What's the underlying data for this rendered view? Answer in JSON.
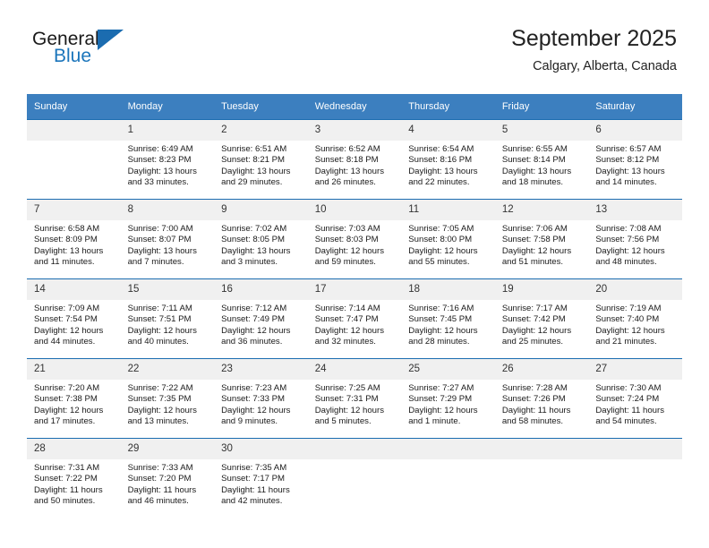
{
  "brand": {
    "name_top": "General",
    "name_bottom": "Blue",
    "triangle_icon": "triangle-logo-icon",
    "color_top": "#1a1a1a",
    "color_bottom": "#1b75bb"
  },
  "header": {
    "title": "September 2025",
    "subtitle": "Calgary, Alberta, Canada"
  },
  "theme": {
    "header_bg": "#3c7fbf",
    "header_text": "#ffffff",
    "row_divider": "#1b6cb0",
    "daynum_bg": "#f0f0f0",
    "cell_bg": "#ffffff"
  },
  "weekday_headers": [
    "Sunday",
    "Monday",
    "Tuesday",
    "Wednesday",
    "Thursday",
    "Friday",
    "Saturday"
  ],
  "labels": {
    "sunrise_prefix": "Sunrise:",
    "sunset_prefix": "Sunset:",
    "daylight_prefix": "Daylight:"
  },
  "weeks": [
    [
      {
        "day": "",
        "sunrise": "",
        "sunset": "",
        "daylight_line1": "",
        "daylight_line2": ""
      },
      {
        "day": "1",
        "sunrise": "Sunrise: 6:49 AM",
        "sunset": "Sunset: 8:23 PM",
        "daylight_line1": "Daylight: 13 hours",
        "daylight_line2": "and 33 minutes."
      },
      {
        "day": "2",
        "sunrise": "Sunrise: 6:51 AM",
        "sunset": "Sunset: 8:21 PM",
        "daylight_line1": "Daylight: 13 hours",
        "daylight_line2": "and 29 minutes."
      },
      {
        "day": "3",
        "sunrise": "Sunrise: 6:52 AM",
        "sunset": "Sunset: 8:18 PM",
        "daylight_line1": "Daylight: 13 hours",
        "daylight_line2": "and 26 minutes."
      },
      {
        "day": "4",
        "sunrise": "Sunrise: 6:54 AM",
        "sunset": "Sunset: 8:16 PM",
        "daylight_line1": "Daylight: 13 hours",
        "daylight_line2": "and 22 minutes."
      },
      {
        "day": "5",
        "sunrise": "Sunrise: 6:55 AM",
        "sunset": "Sunset: 8:14 PM",
        "daylight_line1": "Daylight: 13 hours",
        "daylight_line2": "and 18 minutes."
      },
      {
        "day": "6",
        "sunrise": "Sunrise: 6:57 AM",
        "sunset": "Sunset: 8:12 PM",
        "daylight_line1": "Daylight: 13 hours",
        "daylight_line2": "and 14 minutes."
      }
    ],
    [
      {
        "day": "7",
        "sunrise": "Sunrise: 6:58 AM",
        "sunset": "Sunset: 8:09 PM",
        "daylight_line1": "Daylight: 13 hours",
        "daylight_line2": "and 11 minutes."
      },
      {
        "day": "8",
        "sunrise": "Sunrise: 7:00 AM",
        "sunset": "Sunset: 8:07 PM",
        "daylight_line1": "Daylight: 13 hours",
        "daylight_line2": "and 7 minutes."
      },
      {
        "day": "9",
        "sunrise": "Sunrise: 7:02 AM",
        "sunset": "Sunset: 8:05 PM",
        "daylight_line1": "Daylight: 13 hours",
        "daylight_line2": "and 3 minutes."
      },
      {
        "day": "10",
        "sunrise": "Sunrise: 7:03 AM",
        "sunset": "Sunset: 8:03 PM",
        "daylight_line1": "Daylight: 12 hours",
        "daylight_line2": "and 59 minutes."
      },
      {
        "day": "11",
        "sunrise": "Sunrise: 7:05 AM",
        "sunset": "Sunset: 8:00 PM",
        "daylight_line1": "Daylight: 12 hours",
        "daylight_line2": "and 55 minutes."
      },
      {
        "day": "12",
        "sunrise": "Sunrise: 7:06 AM",
        "sunset": "Sunset: 7:58 PM",
        "daylight_line1": "Daylight: 12 hours",
        "daylight_line2": "and 51 minutes."
      },
      {
        "day": "13",
        "sunrise": "Sunrise: 7:08 AM",
        "sunset": "Sunset: 7:56 PM",
        "daylight_line1": "Daylight: 12 hours",
        "daylight_line2": "and 48 minutes."
      }
    ],
    [
      {
        "day": "14",
        "sunrise": "Sunrise: 7:09 AM",
        "sunset": "Sunset: 7:54 PM",
        "daylight_line1": "Daylight: 12 hours",
        "daylight_line2": "and 44 minutes."
      },
      {
        "day": "15",
        "sunrise": "Sunrise: 7:11 AM",
        "sunset": "Sunset: 7:51 PM",
        "daylight_line1": "Daylight: 12 hours",
        "daylight_line2": "and 40 minutes."
      },
      {
        "day": "16",
        "sunrise": "Sunrise: 7:12 AM",
        "sunset": "Sunset: 7:49 PM",
        "daylight_line1": "Daylight: 12 hours",
        "daylight_line2": "and 36 minutes."
      },
      {
        "day": "17",
        "sunrise": "Sunrise: 7:14 AM",
        "sunset": "Sunset: 7:47 PM",
        "daylight_line1": "Daylight: 12 hours",
        "daylight_line2": "and 32 minutes."
      },
      {
        "day": "18",
        "sunrise": "Sunrise: 7:16 AM",
        "sunset": "Sunset: 7:45 PM",
        "daylight_line1": "Daylight: 12 hours",
        "daylight_line2": "and 28 minutes."
      },
      {
        "day": "19",
        "sunrise": "Sunrise: 7:17 AM",
        "sunset": "Sunset: 7:42 PM",
        "daylight_line1": "Daylight: 12 hours",
        "daylight_line2": "and 25 minutes."
      },
      {
        "day": "20",
        "sunrise": "Sunrise: 7:19 AM",
        "sunset": "Sunset: 7:40 PM",
        "daylight_line1": "Daylight: 12 hours",
        "daylight_line2": "and 21 minutes."
      }
    ],
    [
      {
        "day": "21",
        "sunrise": "Sunrise: 7:20 AM",
        "sunset": "Sunset: 7:38 PM",
        "daylight_line1": "Daylight: 12 hours",
        "daylight_line2": "and 17 minutes."
      },
      {
        "day": "22",
        "sunrise": "Sunrise: 7:22 AM",
        "sunset": "Sunset: 7:35 PM",
        "daylight_line1": "Daylight: 12 hours",
        "daylight_line2": "and 13 minutes."
      },
      {
        "day": "23",
        "sunrise": "Sunrise: 7:23 AM",
        "sunset": "Sunset: 7:33 PM",
        "daylight_line1": "Daylight: 12 hours",
        "daylight_line2": "and 9 minutes."
      },
      {
        "day": "24",
        "sunrise": "Sunrise: 7:25 AM",
        "sunset": "Sunset: 7:31 PM",
        "daylight_line1": "Daylight: 12 hours",
        "daylight_line2": "and 5 minutes."
      },
      {
        "day": "25",
        "sunrise": "Sunrise: 7:27 AM",
        "sunset": "Sunset: 7:29 PM",
        "daylight_line1": "Daylight: 12 hours",
        "daylight_line2": "and 1 minute."
      },
      {
        "day": "26",
        "sunrise": "Sunrise: 7:28 AM",
        "sunset": "Sunset: 7:26 PM",
        "daylight_line1": "Daylight: 11 hours",
        "daylight_line2": "and 58 minutes."
      },
      {
        "day": "27",
        "sunrise": "Sunrise: 7:30 AM",
        "sunset": "Sunset: 7:24 PM",
        "daylight_line1": "Daylight: 11 hours",
        "daylight_line2": "and 54 minutes."
      }
    ],
    [
      {
        "day": "28",
        "sunrise": "Sunrise: 7:31 AM",
        "sunset": "Sunset: 7:22 PM",
        "daylight_line1": "Daylight: 11 hours",
        "daylight_line2": "and 50 minutes."
      },
      {
        "day": "29",
        "sunrise": "Sunrise: 7:33 AM",
        "sunset": "Sunset: 7:20 PM",
        "daylight_line1": "Daylight: 11 hours",
        "daylight_line2": "and 46 minutes."
      },
      {
        "day": "30",
        "sunrise": "Sunrise: 7:35 AM",
        "sunset": "Sunset: 7:17 PM",
        "daylight_line1": "Daylight: 11 hours",
        "daylight_line2": "and 42 minutes."
      },
      {
        "day": "",
        "sunrise": "",
        "sunset": "",
        "daylight_line1": "",
        "daylight_line2": ""
      },
      {
        "day": "",
        "sunrise": "",
        "sunset": "",
        "daylight_line1": "",
        "daylight_line2": ""
      },
      {
        "day": "",
        "sunrise": "",
        "sunset": "",
        "daylight_line1": "",
        "daylight_line2": ""
      },
      {
        "day": "",
        "sunrise": "",
        "sunset": "",
        "daylight_line1": "",
        "daylight_line2": ""
      }
    ]
  ]
}
